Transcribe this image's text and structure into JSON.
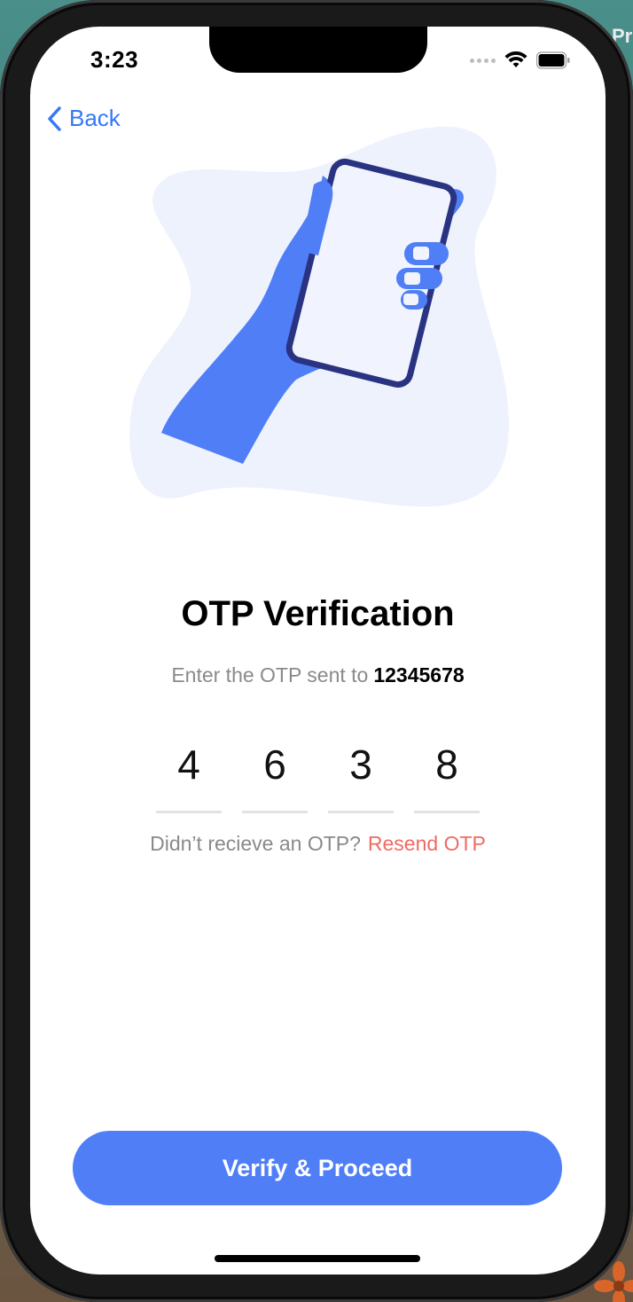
{
  "status_bar": {
    "time": "3:23"
  },
  "nav": {
    "back_label": "Back"
  },
  "main": {
    "title": "OTP Verification",
    "subtitle_prefix": "Enter the OTP sent to",
    "phone_number": "12345678",
    "otp_digits": [
      "4",
      "6",
      "3",
      "8"
    ],
    "resend_prompt": "Didn’t recieve an OTP?",
    "resend_link": "Resend OTP"
  },
  "footer": {
    "verify_label": "Verify & Proceed"
  },
  "background": {
    "partial_text": "Pr\na"
  },
  "colors": {
    "accent": "#4f7ef7",
    "link_blue": "#3478f6",
    "resend_red": "#ef6b62",
    "muted_text": "#8a8a8e",
    "illustration_navy": "#2a3382",
    "illustration_bg": "#eef2fd"
  },
  "icons": {
    "back": "chevron-left-icon",
    "wifi": "wifi-icon",
    "battery": "battery-icon",
    "signal": "cellular-signal-icon",
    "illustration": "hand-holding-phone-illustration"
  }
}
